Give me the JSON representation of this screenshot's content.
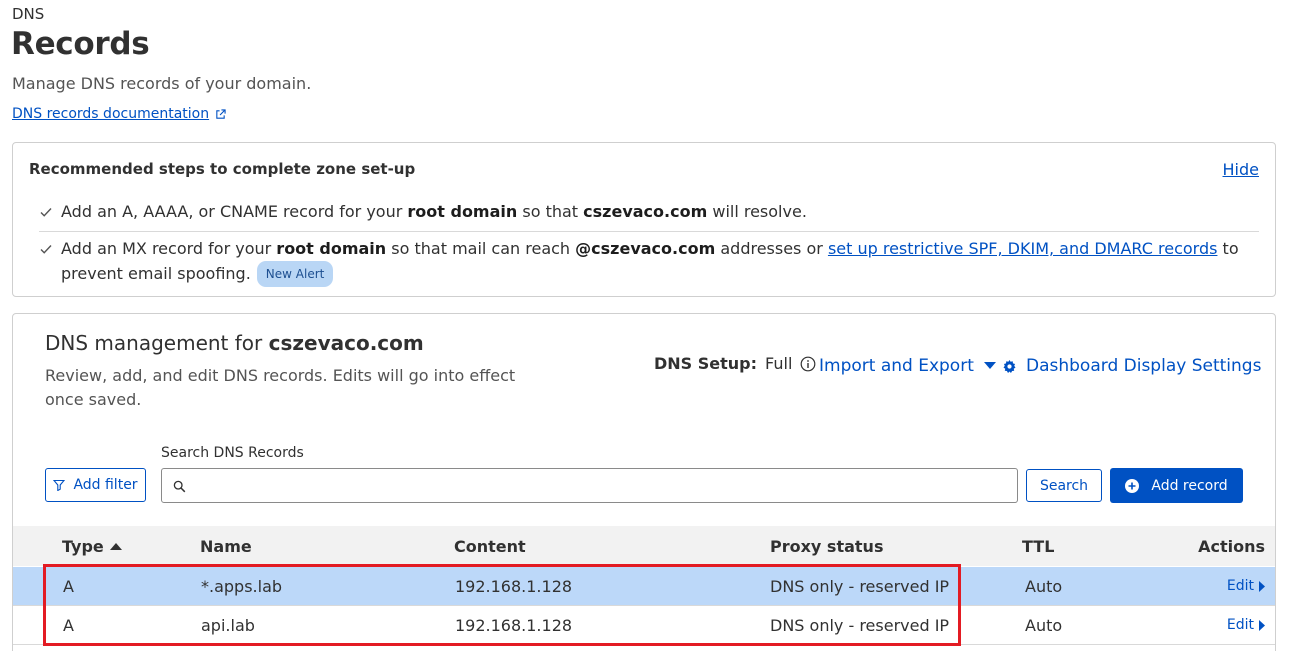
{
  "breadcrumb": "DNS",
  "title": "Records",
  "description": "Manage DNS records of your domain.",
  "doc_link": "DNS records documentation",
  "recommended": {
    "title": "Recommended steps to complete zone set-up",
    "hide": "Hide",
    "step1": {
      "a": "Add an A, AAAA, or CNAME record for your ",
      "b": "root domain",
      "c": " so that ",
      "d": "cszevaco.com",
      "e": " will resolve."
    },
    "step2": {
      "a": "Add an MX record for your ",
      "b": "root domain",
      "c": " so that mail can reach ",
      "d": "@cszevaco.com",
      "e": " addresses or ",
      "link": "set up restrictive SPF, DKIM, and DMARC records",
      "f": " to prevent email spoofing.",
      "badge": "New Alert"
    }
  },
  "management": {
    "title_prefix": "DNS management for ",
    "domain": "cszevaco.com",
    "desc": "Review, add, and edit DNS records. Edits will go into effect once saved.",
    "setup_label": "DNS Setup:",
    "setup_value": "Full",
    "import_export": "Import and Export",
    "display_settings": "Dashboard Display Settings",
    "add_filter": "Add filter",
    "search_label": "Search DNS Records",
    "search_value": "",
    "search_button": "Search",
    "add_record": "Add record"
  },
  "table": {
    "headers": {
      "type": "Type",
      "name": "Name",
      "content": "Content",
      "proxy": "Proxy status",
      "ttl": "TTL",
      "actions": "Actions"
    },
    "rows": [
      {
        "type": "A",
        "name": "*.apps.lab",
        "content": "192.168.1.128",
        "proxy": "DNS only - reserved IP",
        "ttl": "Auto",
        "action": "Edit"
      },
      {
        "type": "A",
        "name": "api.lab",
        "content": "192.168.1.128",
        "proxy": "DNS only - reserved IP",
        "ttl": "Auto",
        "action": "Edit"
      }
    ]
  },
  "colors": {
    "accent": "#0051c3",
    "selected_row": "#bcd8f9",
    "highlight": "#e31b23",
    "badge_bg": "#b9d6f5"
  }
}
